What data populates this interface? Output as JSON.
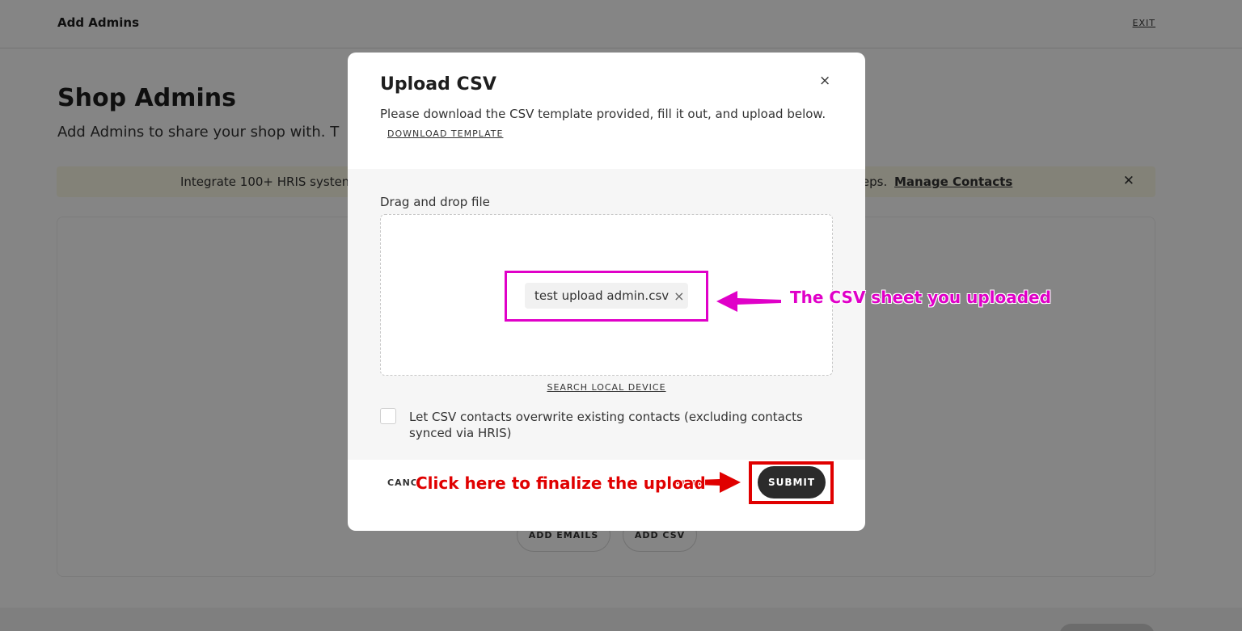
{
  "topbar": {
    "title": "Add Admins",
    "exit_label": "EXIT"
  },
  "page": {
    "title": "Shop Admins",
    "subtitle": "Add Admins to share your shop with. T"
  },
  "banner": {
    "text_left": "Integrate 100+ HRIS system",
    "text_right": "teps.",
    "link_label": "Manage Contacts",
    "close_icon": "close-icon"
  },
  "card": {
    "add_emails_label": "ADD EMAILS",
    "add_csv_label": "ADD CSV"
  },
  "modal": {
    "title": "Upload CSV",
    "close_glyph": "×",
    "description": "Please download the CSV template provided, fill it out, and upload below.",
    "download_label": "DOWNLOAD TEMPLATE",
    "drag_drop_label": "Drag and drop file",
    "file_name": "test upload admin.csv",
    "file_remove_glyph": "×",
    "search_local_label": "SEARCH LOCAL DEVICE",
    "checkbox_label": "Let CSV contacts overwrite existing contacts (excluding contacts synced via HRIS)",
    "checkbox_checked": false,
    "cancel_label": "CANC",
    "submit_label": "SUBMIT"
  },
  "annotations": {
    "file_callout": "The CSV sheet you uploaded",
    "submit_callout": "Click here to finalize the upload",
    "colors": {
      "magenta": "#e000c8",
      "red": "#e00000"
    }
  }
}
